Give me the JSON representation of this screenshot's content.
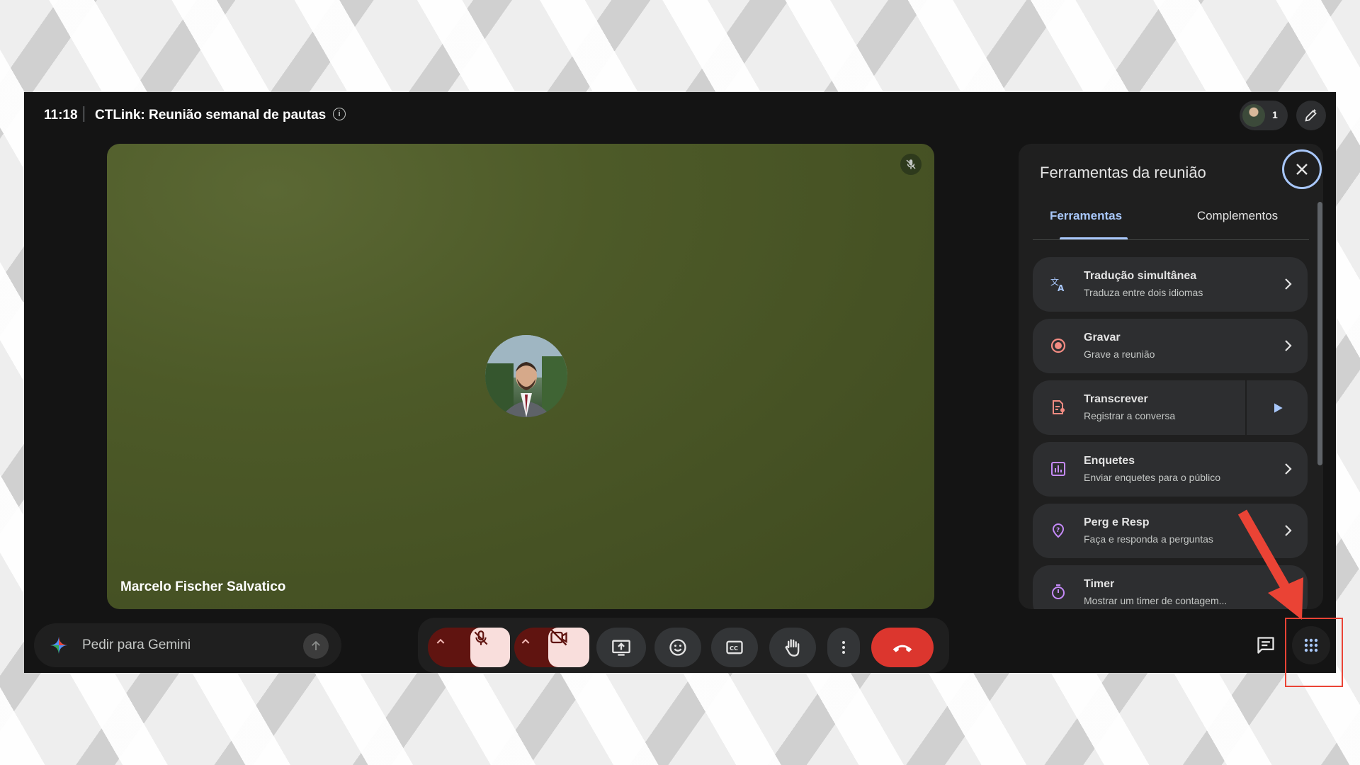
{
  "topbar": {
    "time": "11:18",
    "meeting_title": "CTLink: Reunião semanal de pautas",
    "participant_count": "1"
  },
  "tile": {
    "participant_name": "Marcelo Fischer Salvatico"
  },
  "panel": {
    "title": "Ferramentas da reunião",
    "tabs": [
      {
        "label": "Ferramentas",
        "active": true
      },
      {
        "label": "Complementos",
        "active": false
      }
    ],
    "tools": [
      {
        "title": "Tradução simultânea",
        "subtitle": "Traduza entre dois idiomas",
        "icon": "translate-icon"
      },
      {
        "title": "Gravar",
        "subtitle": "Grave a reunião",
        "icon": "record-icon"
      },
      {
        "title": "Transcrever",
        "subtitle": "Registrar a conversa",
        "icon": "transcribe-icon"
      },
      {
        "title": "Enquetes",
        "subtitle": "Enviar enquetes para o público",
        "icon": "poll-icon"
      },
      {
        "title": "Perg e Resp",
        "subtitle": "Faça e responda a perguntas",
        "icon": "qa-icon"
      },
      {
        "title": "Timer",
        "subtitle": "Mostrar um timer de contagem...",
        "icon": "timer-icon"
      }
    ]
  },
  "gemini": {
    "placeholder": "Pedir para Gemini"
  },
  "colors": {
    "accent": "#a8c7fa",
    "end_call": "#dc362e",
    "muted_bg": "#f9dedc",
    "muted_dark": "#601410",
    "annotation": "#ea4335"
  }
}
